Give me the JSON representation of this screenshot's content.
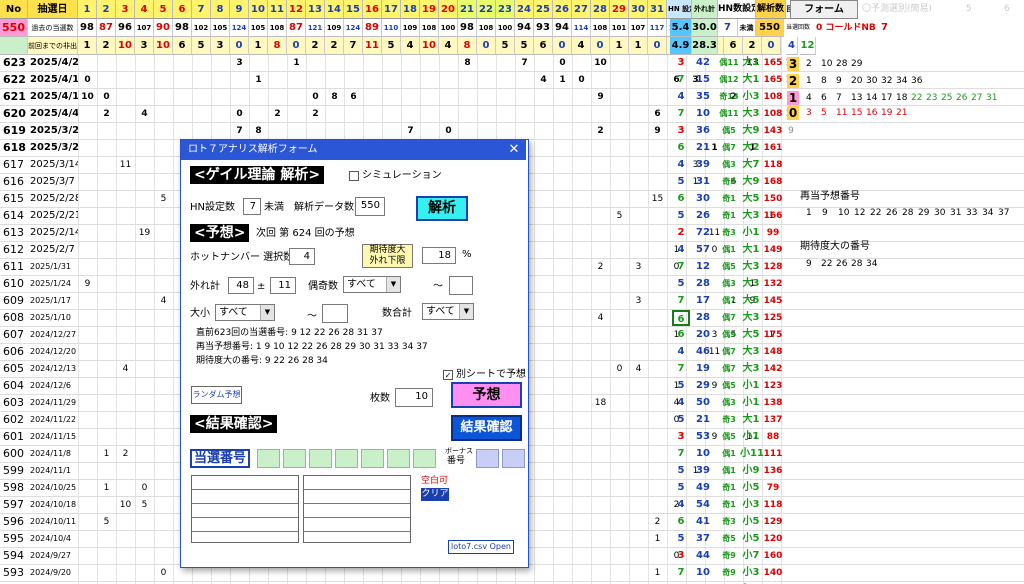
{
  "header": {
    "no": "No",
    "date": "抽選日",
    "nums": [
      "1",
      "2",
      "3",
      "4",
      "5",
      "6",
      "7",
      "8",
      "9",
      "10",
      "11",
      "12",
      "13",
      "14",
      "15",
      "16",
      "17",
      "18",
      "19",
      "20",
      "21",
      "22",
      "23",
      "24",
      "25",
      "26",
      "27",
      "28",
      "29",
      "30",
      "31",
      "32",
      "33",
      "34",
      "35",
      "36",
      "37"
    ],
    "extra": [
      "回目",
      "HN 設定",
      "外れ計",
      "HN数設定",
      "解析数"
    ],
    "form_button": "フォーム",
    "faded": [
      "〇予測選別(簡易)",
      "5",
      "6"
    ]
  },
  "summary": {
    "count_label": "550",
    "row1_label": "過去の当選数",
    "row1": [
      "98",
      "87",
      "96",
      "107",
      "90",
      "98",
      "102",
      "105",
      "124",
      "105",
      "108",
      "87",
      "121",
      "109",
      "124",
      "89",
      "110",
      "109",
      "108",
      "100",
      "98",
      "108",
      "100",
      "94",
      "93",
      "94",
      "114",
      "108",
      "101",
      "107",
      "117",
      "113",
      "86",
      "114",
      "109",
      "110",
      "94"
    ],
    "row2_label": "前回までの非出現",
    "row2": [
      "1",
      "2",
      "10",
      "3",
      "10",
      "6",
      "5",
      "3",
      "0",
      "1",
      "8",
      "0",
      "2",
      "2",
      "7",
      "11",
      "5",
      "4",
      "10",
      "4",
      "8",
      "0",
      "5",
      "5",
      "6",
      "0",
      "4",
      "0",
      "1",
      "1",
      "0",
      "3",
      "1",
      "1",
      "6",
      "2",
      "0"
    ],
    "stat_a": "5.4",
    "stat_b": "30.0",
    "hn_setting": "7",
    "hn_unit": "未満",
    "analysis_count": "550",
    "stat_c": "4.9",
    "stat_d": "28.3",
    "side_4": "4",
    "side_12": "12",
    "mini_label": "当選回数",
    "cold_label": "0 コールドNB",
    "cold_val": "7"
  },
  "rows": [
    {
      "no": "623",
      "date": "2025/4/25",
      "cells": {
        "9": "3",
        "12": "1",
        "21": "8",
        "24": "7",
        "26": "0",
        "28": "10",
        "36": "13"
      },
      "round": "10",
      "a": "3",
      "b": "42",
      "c": "偶11",
      "d": "大1",
      "e": "165"
    },
    {
      "no": "622",
      "date": "2025/4/18",
      "cells": {
        "1": "0",
        "10": "1",
        "25": "4",
        "26": "1",
        "27": "0",
        "32": "6",
        "33": "3"
      },
      "round": "10",
      "a": "7",
      "b": "15",
      "c": "偶12",
      "d": "大1",
      "e": "165"
    },
    {
      "no": "621",
      "date": "2025/4/11",
      "cells": {
        "1": "10",
        "2": "0",
        "13": "0",
        "14": "8",
        "15": "6",
        "28": "9",
        "35": "2"
      },
      "round": "9",
      "a": "4",
      "b": "35",
      "c": "奇13",
      "d": "小3",
      "e": "108"
    },
    {
      "no": "620",
      "date": "2025/4/4",
      "cells": {
        "2": "2",
        "4": "4",
        "9": "0",
        "11": "2",
        "13": "2",
        "31": "6"
      },
      "round": "10",
      "a": "7",
      "b": "10",
      "c": "偶11",
      "d": "大3",
      "e": "108"
    },
    {
      "no": "619",
      "date": "2025/3/28",
      "cells": {
        "9": "7",
        "10": "8",
        "18": "7",
        "20": "0",
        "28": "2",
        "31": "9"
      },
      "round": "9",
      "a": "3",
      "b": "36",
      "c": "偶5",
      "d": "大9",
      "e": "143"
    },
    {
      "no": "618",
      "date": "2025/3/21",
      "cells": {
        "9": "1",
        "34": "1",
        "36": "1"
      },
      "round": "",
      "a": "6",
      "b": "21",
      "c": "偶7",
      "d": "大2",
      "e": "161"
    },
    {
      "no": "617",
      "date": "2025/3/14",
      "cells": {
        "3": "11",
        "8": "3",
        "33": "3"
      },
      "round": "",
      "a": "4",
      "b": "39",
      "c": "偶3",
      "d": "大7",
      "e": "118"
    },
    {
      "no": "616",
      "date": "2025/3/7",
      "cells": {
        "33": "1",
        "35": "6"
      },
      "round": "",
      "a": "5",
      "b": "31",
      "c": "奇3",
      "d": "大9",
      "e": "168"
    },
    {
      "no": "615",
      "date": "2025/2/28",
      "cells": {
        "5": "5",
        "31": "15"
      },
      "round": "",
      "a": "6",
      "b": "30",
      "c": "奇1",
      "d": "大5",
      "e": "150"
    },
    {
      "no": "614",
      "date": "2025/2/21",
      "cells": {
        "29": "5",
        "37": "1"
      },
      "round": "",
      "a": "5",
      "b": "26",
      "c": "奇1",
      "d": "大3",
      "e": "166"
    },
    {
      "no": "613",
      "date": "2025/2/14",
      "cells": {
        "4": "19",
        "6": "0",
        "7": "8",
        "34": "11"
      },
      "round": "",
      "a": "2",
      "b": "72",
      "c": "奇3",
      "d": "小1",
      "e": "99"
    },
    {
      "no": "612",
      "date": "2025/2/7",
      "cells": {
        "7": "17",
        "32": "1",
        "34": "0"
      },
      "round": "",
      "a": "4",
      "b": "57",
      "c": "偶1",
      "d": "大1",
      "e": "149"
    },
    {
      "no": "611",
      "date": "2025/1/31",
      "cells": {
        "28": "2",
        "30": "3",
        "32": "0"
      },
      "round": "",
      "a": "7",
      "b": "12",
      "c": "偶5",
      "d": "大3",
      "e": "128"
    },
    {
      "no": "610",
      "date": "2025/1/24",
      "cells": {
        "1": "9",
        "36": "1"
      },
      "round": "",
      "a": "5",
      "b": "28",
      "c": "偶3",
      "d": "大3",
      "e": "132"
    },
    {
      "no": "609",
      "date": "2025/1/17",
      "cells": {
        "5": "4",
        "30": "3",
        "35": "1",
        "36": "9"
      },
      "round": "",
      "a": "7",
      "b": "17",
      "c": "偶7",
      "d": "大5",
      "e": "145"
    },
    {
      "no": "608",
      "date": "2025/1/10",
      "cells": {
        "28": "4"
      },
      "round": "",
      "a": "6",
      "b": "28",
      "c": "偶7",
      "d": "大3",
      "e": "125"
    },
    {
      "no": "607",
      "date": "2024/12/27",
      "cells": {
        "32": "1",
        "34": "3",
        "35": "5",
        "37": "1"
      },
      "round": "",
      "a": "6",
      "b": "20",
      "c": "偶9",
      "d": "大5",
      "e": "175"
    },
    {
      "no": "606",
      "date": "2024/12/20",
      "cells": {
        "34": "11"
      },
      "round": "",
      "a": "4",
      "b": "46",
      "c": "偶7",
      "d": "大3",
      "e": "148"
    },
    {
      "no": "605",
      "date": "2024/12/13",
      "cells": {
        "3": "4",
        "29": "0",
        "30": "4"
      },
      "round": "",
      "a": "7",
      "b": "19",
      "c": "偶7",
      "d": "大3",
      "e": "142"
    },
    {
      "no": "604",
      "date": "2024/12/6",
      "cells": {
        "6": "0",
        "8": "14",
        "32": "1",
        "34": "9"
      },
      "round": "",
      "a": "5",
      "b": "29",
      "c": "偶5",
      "d": "小1",
      "e": "123"
    },
    {
      "no": "603",
      "date": "2024/11/29",
      "cells": {
        "6": "1",
        "28": "18",
        "32": "4"
      },
      "round": "",
      "a": "4",
      "b": "50",
      "c": "偶3",
      "d": "小1",
      "e": "138"
    },
    {
      "no": "602",
      "date": "2024/11/22",
      "cells": {
        "32": "0"
      },
      "round": "",
      "a": "5",
      "b": "21",
      "c": "奇3",
      "d": "大1",
      "e": "137"
    },
    {
      "no": "601",
      "date": "2024/11/15",
      "cells": {
        "6": "1",
        "34": "9",
        "36": "17"
      },
      "round": "",
      "a": "3",
      "b": "53",
      "c": "偶5",
      "d": "小1",
      "e": "88"
    },
    {
      "no": "600",
      "date": "2024/11/8",
      "cells": {
        "2": "1",
        "3": "2"
      },
      "round": "",
      "a": "7",
      "b": "10",
      "c": "偶1",
      "d": "小11",
      "e": "111"
    },
    {
      "no": "599",
      "date": "2024/11/1",
      "cells": {
        "6": "0",
        "33": "1"
      },
      "round": "",
      "a": "5",
      "b": "39",
      "c": "偶1",
      "d": "小9",
      "e": "136"
    },
    {
      "no": "598",
      "date": "2024/10/25",
      "cells": {
        "2": "1",
        "4": "0",
        "6": "6"
      },
      "round": "",
      "a": "5",
      "b": "49",
      "c": "奇1",
      "d": "小5",
      "e": "79"
    },
    {
      "no": "597",
      "date": "2024/10/18",
      "cells": {
        "3": "10",
        "4": "5",
        "32": "2"
      },
      "round": "",
      "a": "4",
      "b": "54",
      "c": "奇1",
      "d": "小3",
      "e": "118"
    },
    {
      "no": "596",
      "date": "2024/10/11",
      "cells": {
        "2": "5",
        "31": "2"
      },
      "round": "",
      "a": "6",
      "b": "41",
      "c": "奇3",
      "d": "小5",
      "e": "129"
    },
    {
      "no": "595",
      "date": "2024/10/4",
      "cells": {
        "31": "1"
      },
      "round": "",
      "a": "5",
      "b": "37",
      "c": "奇5",
      "d": "小5",
      "e": "120"
    },
    {
      "no": "594",
      "date": "2024/9/27",
      "cells": {
        "7": "5",
        "32": "0"
      },
      "round": "",
      "a": "3",
      "b": "44",
      "c": "奇9",
      "d": "小7",
      "e": "160"
    },
    {
      "no": "593",
      "date": "2024/9/20",
      "cells": {
        "5": "0",
        "31": "1"
      },
      "round": "",
      "a": "7",
      "b": "10",
      "c": "奇9",
      "d": "小3",
      "e": "140"
    },
    {
      "no": "592",
      "date": "2024/9/13",
      "cells": {
        "5": "1",
        "10": "0",
        "13": "0",
        "15": "1",
        "19": "12",
        "22": "21",
        "35": "1"
      },
      "round": "",
      "a": "5",
      "b": "45",
      "c": "偶17",
      "d": "小13",
      "e": "112"
    }
  ],
  "side": {
    "r1": [
      "3",
      "2",
      "10",
      "28",
      "29"
    ],
    "r2": [
      "2",
      "1",
      "8",
      "9",
      "20",
      "30",
      "32",
      "34",
      "36"
    ],
    "r3": [
      "1",
      "4",
      "6",
      "7",
      "13",
      "14",
      "17",
      "18",
      "22",
      "23",
      "25",
      "26",
      "27",
      "31"
    ],
    "r4": [
      "0",
      "3",
      "5",
      "11",
      "15",
      "16",
      "19",
      "21"
    ],
    "repeat_label": "再当予想番号",
    "repeat_nums": [
      "1",
      "9",
      "10",
      "12",
      "22",
      "26",
      "28",
      "29",
      "30",
      "31",
      "33",
      "34",
      "37"
    ],
    "expect_label": "期待度大の番号",
    "expect_nums": [
      "9",
      "22",
      "26",
      "28",
      "34"
    ]
  },
  "dialog": {
    "title": "ロト７アナリス解析フォーム",
    "close": "✕",
    "section1": "<ゲイル理論 解析>",
    "sim_label": "シミュレーション",
    "hn_label": "HN設定数",
    "hn_value": "7",
    "hn_unit": "未満",
    "data_label": "解析データ数",
    "data_value": "550",
    "analyze_btn": "解析",
    "section2": "<予想>",
    "next_label": "次回 第 624 回の予想",
    "expect_btn_l1": "期待度大",
    "expect_btn_l2": "外れ下限",
    "expect_value": "18",
    "percent": "%",
    "hot_label": "ホットナンバー 選択数",
    "hot_value": "4",
    "miss_label": "外れ計",
    "miss_value": "48",
    "plusminus": "±",
    "miss_range": "11",
    "evenodd_label": "偶奇数",
    "evenodd_value": "すべて",
    "tilde1": "～",
    "size_label": "大小",
    "size_value": "すべて",
    "tilde2": "～",
    "sum_label": "数合計",
    "sum_value": "すべて",
    "info1": "直前623回の当選番号: 9 12 22 26 28 31 37",
    "info2": "再当予想番号: 1 9 10 12 22 26 28 29 30 31 33 34 37",
    "info3": "期待度大の番号: 9 22 26 28 34",
    "sep_sheet_label": "別シートで予想",
    "random_btn": "ランダム予想",
    "count_label": "枚数",
    "count_value": "10",
    "predict_btn": "予想",
    "section3": "<結果確認>",
    "result_btn": "結果確認",
    "win_label": "当選番号",
    "bonus_l1": "ボーナス",
    "bonus_l2": "番号",
    "blank_label": "空白可",
    "clear_btn": "クリア",
    "open_btn": "loto7.csv Open"
  },
  "colors": {
    "hdr_yellow": "#fff46b",
    "hdr_label": "#ffe04d",
    "green_bg": "#c9f0c9",
    "blue_bg": "#c8e6ff",
    "pink": "#ff8ff0",
    "dialog_title": "#2b57d6"
  }
}
